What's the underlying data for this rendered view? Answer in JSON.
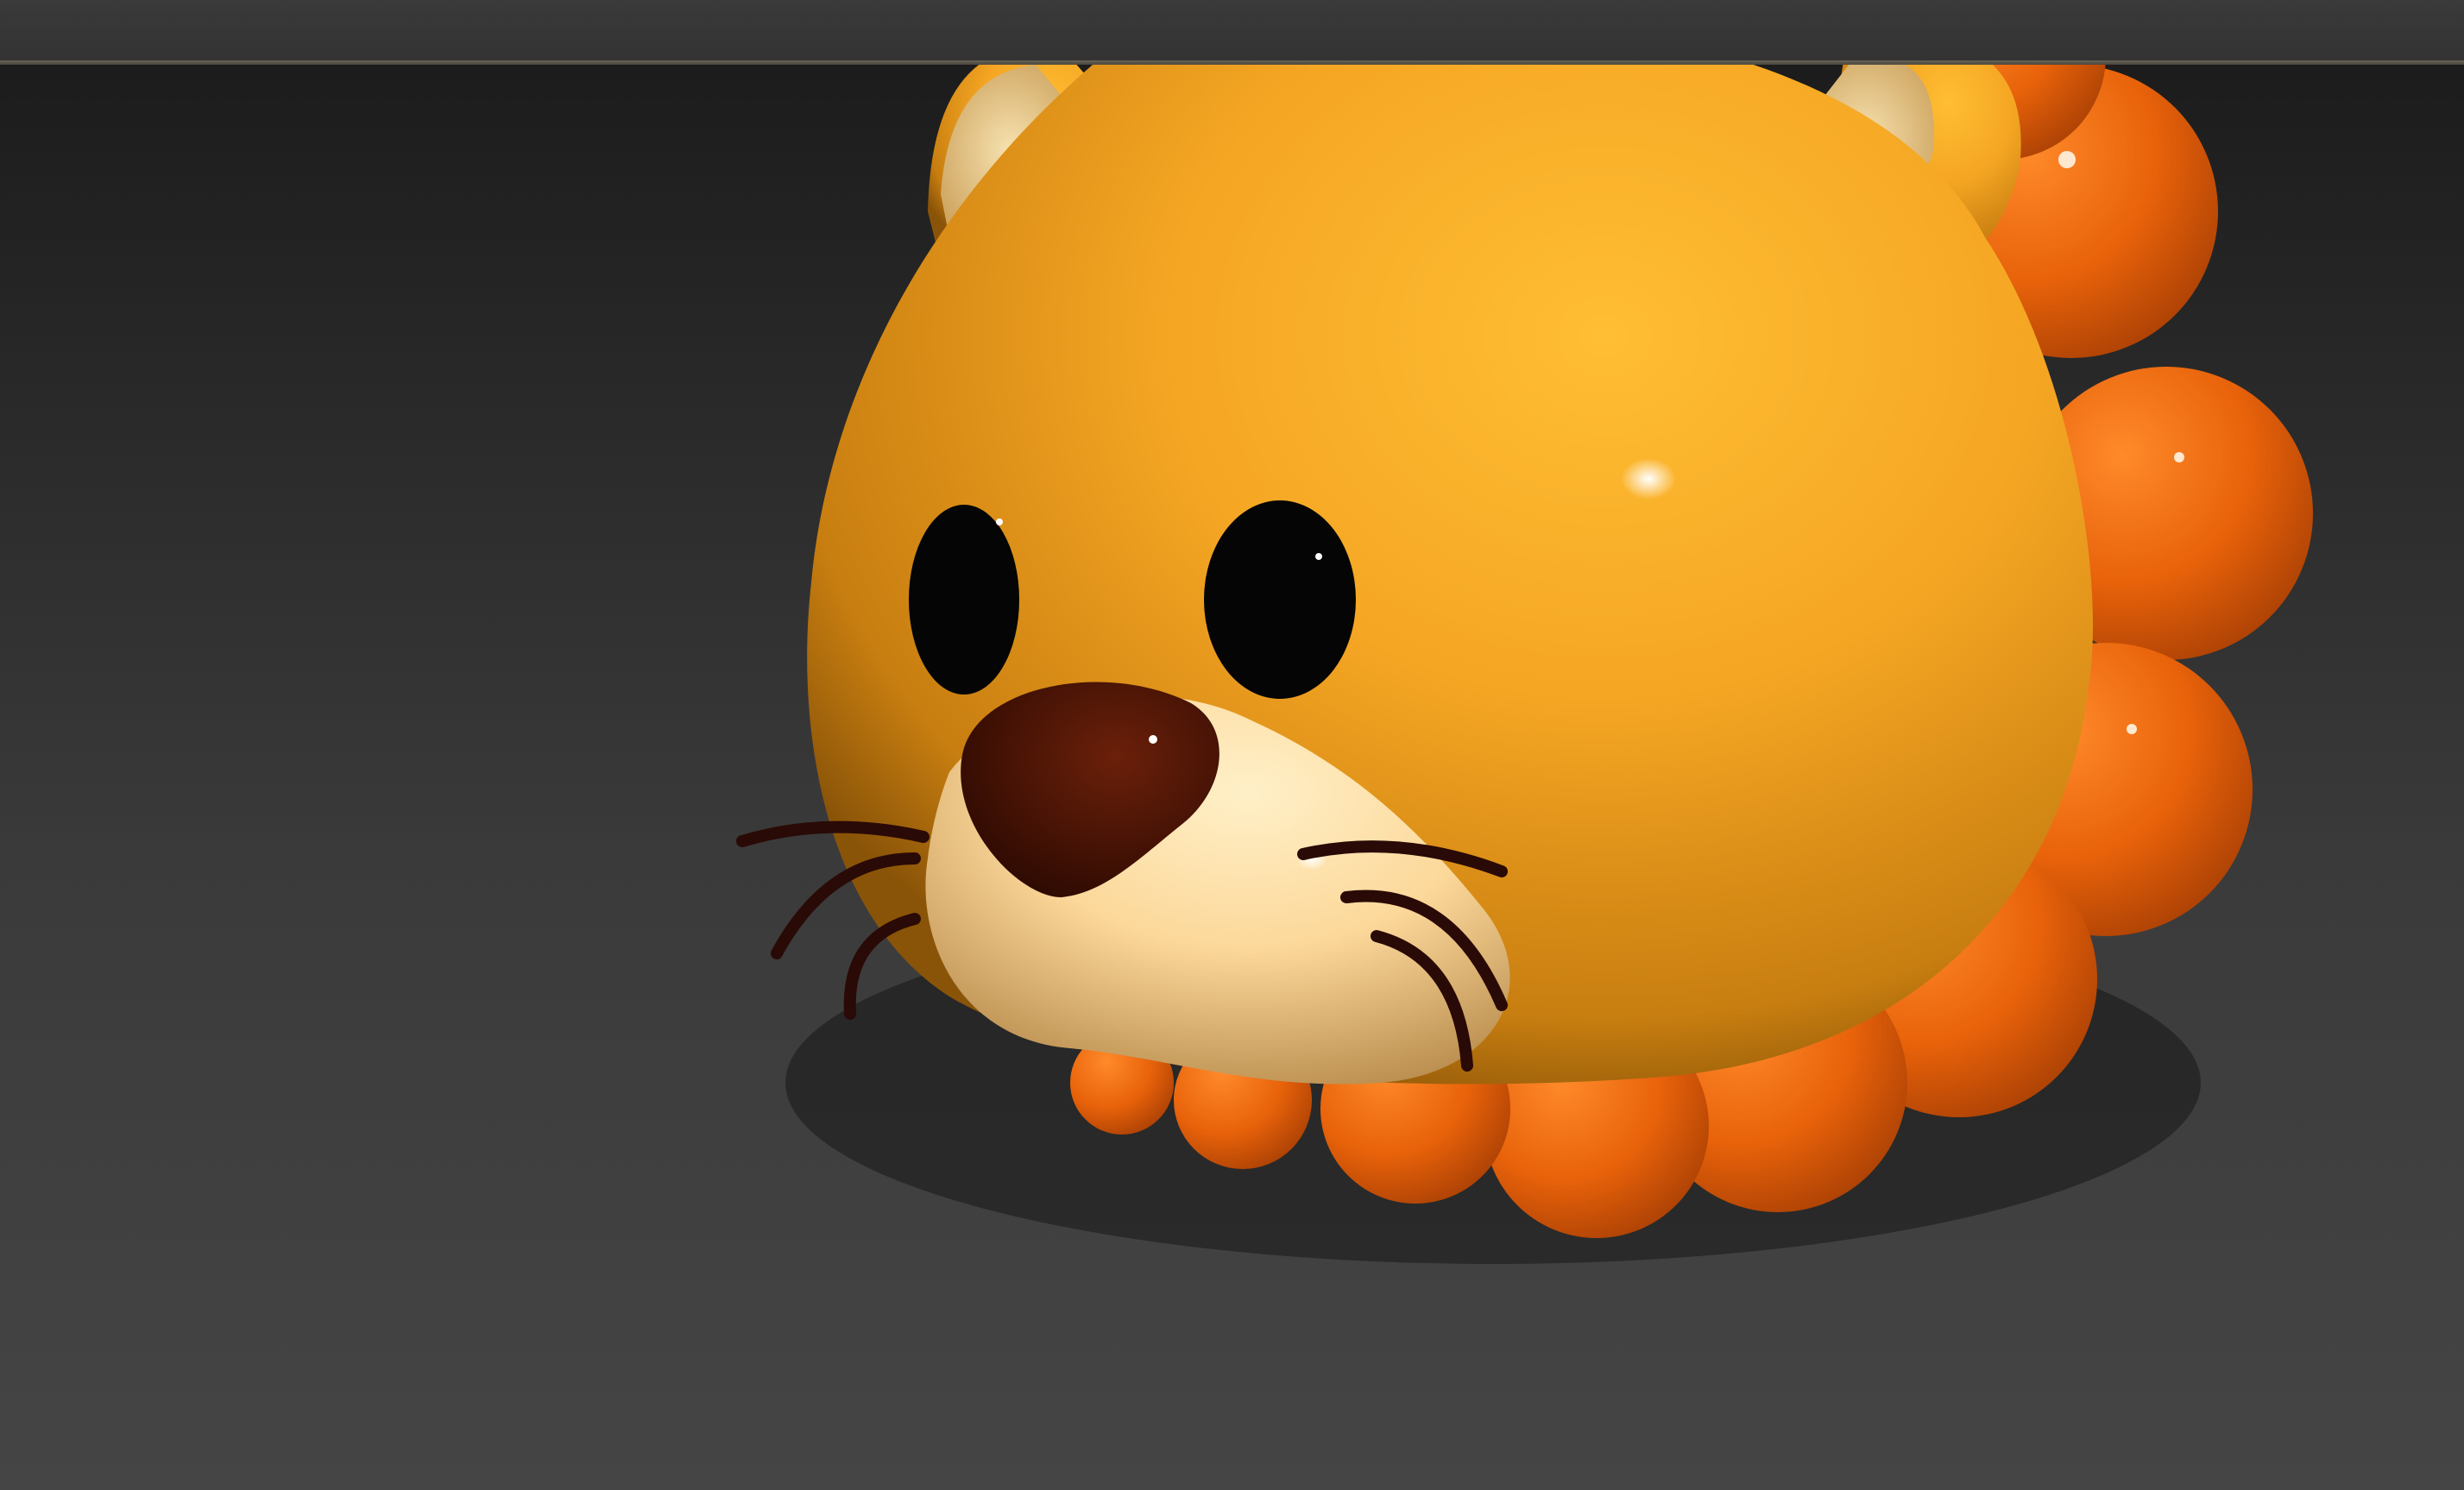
{
  "app": {
    "kind": "3d-viewport",
    "background_top": "#1c1c1c",
    "background_bottom": "#454545"
  },
  "viewport": {
    "model": {
      "name": "lion-head",
      "colors": {
        "face": "#f5a623",
        "face_highlight": "#ffbb33",
        "mane": "#e8620a",
        "mane_highlight": "#ff8a2a",
        "muzzle": "#fcd89a",
        "ear_inner": "#f3d79b",
        "eye": "#050505",
        "nose": "#4a1204",
        "whisker": "#2a0a06"
      },
      "icons": [
        "lion-face-icon"
      ]
    }
  }
}
